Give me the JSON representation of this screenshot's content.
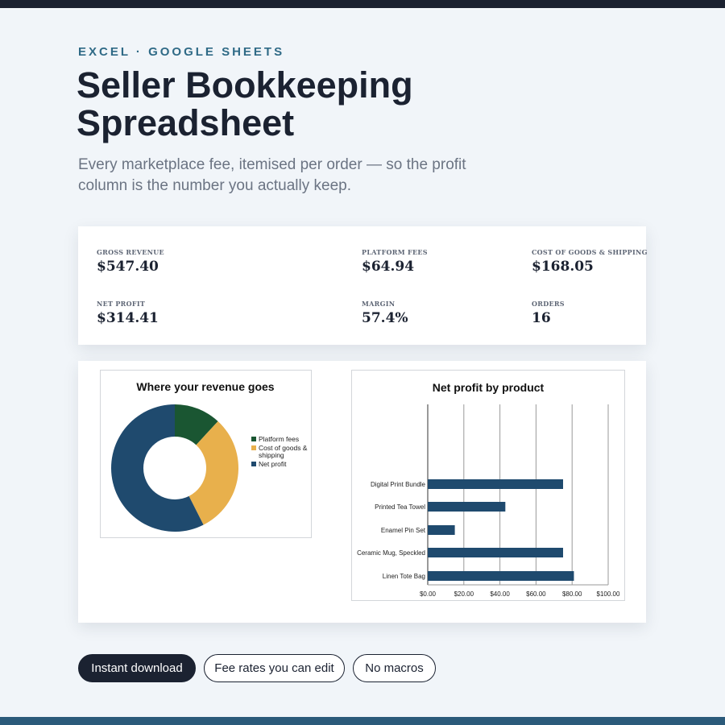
{
  "header": {
    "eyebrow": "EXCEL · GOOGLE SHEETS",
    "title": "Seller Bookkeeping Spreadsheet",
    "subtitle": "Every marketplace fee, itemised per order — so the profit column is the number you actually keep."
  },
  "stats": [
    {
      "label": "GROSS REVENUE",
      "value": "$547.40"
    },
    {
      "label": "PLATFORM FEES",
      "value": "$64.94"
    },
    {
      "label": "COST OF GOODS & SHIPPING",
      "value": "$168.05"
    },
    {
      "label": "NET PROFIT",
      "value": "$314.41"
    },
    {
      "label": "MARGIN",
      "value": "57.4%"
    },
    {
      "label": "ORDERS",
      "value": "16"
    }
  ],
  "pills": [
    "Instant download",
    "Fee rates you can edit",
    "No macros"
  ],
  "colors": {
    "dark": "#1b2231",
    "platform_fees": "#1a5632",
    "cogs": "#e8b04c",
    "net_profit": "#1f4a6e"
  },
  "chart_data": [
    {
      "type": "pie",
      "title": "Where your revenue goes",
      "categories": [
        "Platform fees",
        "Cost of goods & shipping",
        "Net profit"
      ],
      "values": [
        64.94,
        168.05,
        314.41
      ],
      "colors": [
        "#1a5632",
        "#e8b04c",
        "#1f4a6e"
      ],
      "donut": true,
      "legend": "right"
    },
    {
      "type": "bar",
      "orientation": "horizontal",
      "title": "Net profit by product",
      "categories": [
        "Linen Tote Bag",
        "Ceramic Mug, Speckled",
        "Enamel Pin Set",
        "Printed Tea Towel",
        "Digital Print Bundle"
      ],
      "values": [
        81,
        75,
        15,
        43,
        75
      ],
      "xlim": [
        0,
        100
      ],
      "xticks": [
        "$0.00",
        "$20.00",
        "$40.00",
        "$60.00",
        "$80.00",
        "$100.00"
      ],
      "color": "#1f4a6e",
      "grid": true
    }
  ]
}
